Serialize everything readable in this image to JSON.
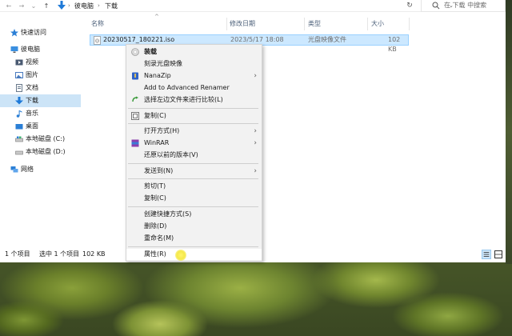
{
  "address": {
    "crumbs": [
      "彼电脑",
      "下载"
    ],
    "separator": "›",
    "search_placeholder": "在 下载 中搜索"
  },
  "sidebar": {
    "items": [
      {
        "label": "快速访问",
        "icon": "star-icon"
      },
      {
        "label": "彼电脑",
        "icon": "computer-icon"
      },
      {
        "label": "视频",
        "icon": "video-icon"
      },
      {
        "label": "图片",
        "icon": "picture-icon"
      },
      {
        "label": "文档",
        "icon": "document-icon"
      },
      {
        "label": "下载",
        "icon": "download-icon"
      },
      {
        "label": "音乐",
        "icon": "music-icon"
      },
      {
        "label": "桌面",
        "icon": "desktop-icon"
      },
      {
        "label": "本地磁盘 (C:)",
        "icon": "drive-icon"
      },
      {
        "label": "本地磁盘 (D:)",
        "icon": "drive-icon"
      },
      {
        "label": "网络",
        "icon": "network-icon"
      }
    ]
  },
  "columns": {
    "name": "名称",
    "modified": "修改日期",
    "type": "类型",
    "size": "大小"
  },
  "file": {
    "name": "20230517_180221.iso",
    "modified": "2023/5/17 18:08",
    "type": "光盘映像文件",
    "size": "102 KB"
  },
  "status": {
    "count": "1 个项目",
    "selected": "选中 1 个项目",
    "size": "102 KB"
  },
  "context_menu": {
    "items": [
      {
        "label": "装载",
        "icon": "disc-icon",
        "bold": true
      },
      {
        "label": "刻录光盘映像",
        "icon": ""
      },
      {
        "label": "NanaZip",
        "icon": "nanazip-icon",
        "submenu": true
      },
      {
        "label": "Add to Advanced Renamer",
        "icon": ""
      },
      {
        "label": "选择左边文件来进行比较(L)",
        "icon": "compare-icon"
      },
      {
        "label": "复制(C)",
        "icon": "copy-icon"
      },
      {
        "label": "打开方式(H)",
        "icon": "",
        "submenu": true
      },
      {
        "label": "WinRAR",
        "icon": "winrar-icon",
        "submenu": true
      },
      {
        "label": "还原以前的版本(V)",
        "icon": ""
      },
      {
        "label": "发送到(N)",
        "icon": "",
        "submenu": true
      },
      {
        "label": "剪切(T)",
        "icon": ""
      },
      {
        "label": "复制(C)",
        "icon": ""
      },
      {
        "label": "创建快捷方式(S)",
        "icon": ""
      },
      {
        "label": "删除(D)",
        "icon": ""
      },
      {
        "label": "重命名(M)",
        "icon": ""
      },
      {
        "label": "属性(R)",
        "icon": ""
      }
    ]
  },
  "colors": {
    "selection": "#cce8ff",
    "accent": "#0078d4"
  }
}
